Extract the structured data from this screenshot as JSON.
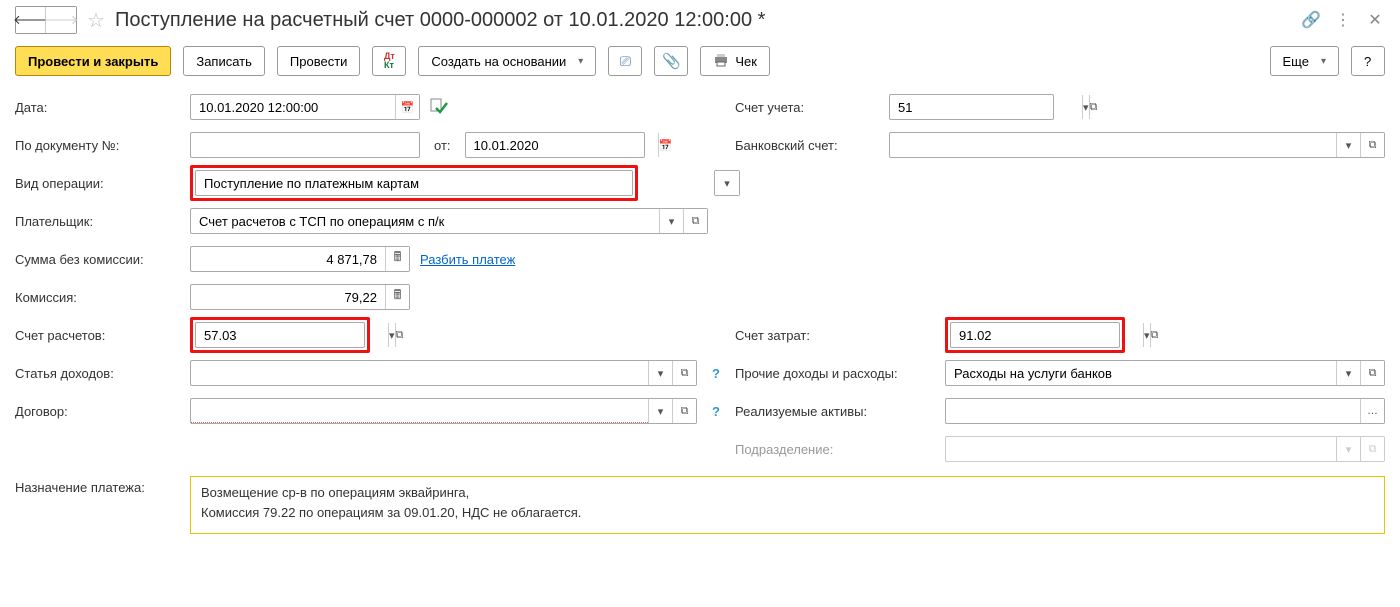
{
  "title": "Поступление на расчетный счет 0000-000002 от 10.01.2020 12:00:00 *",
  "toolbar": {
    "provesti_zakryt": "Провести и закрыть",
    "zapisat": "Записать",
    "provesti": "Провести",
    "sozdat_na_osnovanii": "Создать на основании",
    "chek": "Чек",
    "eshche": "Еще",
    "help": "?"
  },
  "labels": {
    "data": "Дата:",
    "po_dokumentu": "По документу №:",
    "ot": "от:",
    "vid_operacii": "Вид операции:",
    "platelshchik": "Плательщик:",
    "summa_bez_komissii": "Сумма без комиссии:",
    "komissiya": "Комиссия:",
    "schet_raschetov": "Счет расчетов:",
    "statya_dohodov": "Статья доходов:",
    "dogovor": "Договор:",
    "naznachenie": "Назначение платежа:",
    "schet_ucheta": "Счет учета:",
    "bankovskiy_schet": "Банковский счет:",
    "schet_zatrat": "Счет затрат:",
    "prochie_dohody": "Прочие доходы и расходы:",
    "realizuemye_aktivy": "Реализуемые активы:",
    "podrazdelenie": "Подразделение:"
  },
  "values": {
    "data": "10.01.2020 12:00:00",
    "po_dokumentu": "",
    "ot_date": "10.01.2020",
    "vid_operacii": "Поступление по платежным картам",
    "platelshchik": "Счет расчетов с ТСП по операциям с п/к",
    "summa_bez_komissii": "4 871,78",
    "komissiya": "79,22",
    "schet_raschetov": "57.03",
    "statya_dohodov": "",
    "dogovor": "",
    "schet_ucheta": "51",
    "bankovskiy_schet": "",
    "schet_zatrat": "91.02",
    "prochie_dohody": "Расходы на услуги банков",
    "realizuemye_aktivy": "",
    "podrazdelenie": "",
    "naznachenie_line1": "Возмещение ср-в по операциям эквайринга,",
    "naznachenie_line2": "Комиссия 79.22 по операциям за 09.01.20, НДС не облагается."
  },
  "links": {
    "razbit_platezh": "Разбить платеж"
  }
}
